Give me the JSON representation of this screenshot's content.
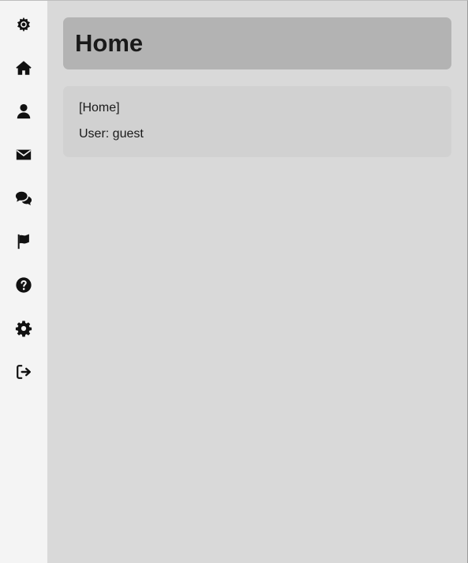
{
  "sidebar": {
    "items": [
      {
        "icon": "sun-gear-icon",
        "name": "nav-item-top"
      },
      {
        "icon": "home-icon",
        "name": "nav-item-home"
      },
      {
        "icon": "user-icon",
        "name": "nav-item-profile"
      },
      {
        "icon": "envelope-icon",
        "name": "nav-item-mail"
      },
      {
        "icon": "comments-icon",
        "name": "nav-item-chat"
      },
      {
        "icon": "flag-icon",
        "name": "nav-item-flag"
      },
      {
        "icon": "question-circle-icon",
        "name": "nav-item-help"
      },
      {
        "icon": "gear-icon",
        "name": "nav-item-settings"
      },
      {
        "icon": "sign-out-icon",
        "name": "nav-item-logout"
      }
    ]
  },
  "header": {
    "title": "Home"
  },
  "panel": {
    "route": "[Home]",
    "user": "User: guest"
  },
  "colors": {
    "sidebar_bg": "#f4f4f4",
    "main_bg": "#d9d9d9",
    "header_bg": "#b3b3b3",
    "panel_bg": "#d1d1d1",
    "text": "#1a1a1a"
  }
}
